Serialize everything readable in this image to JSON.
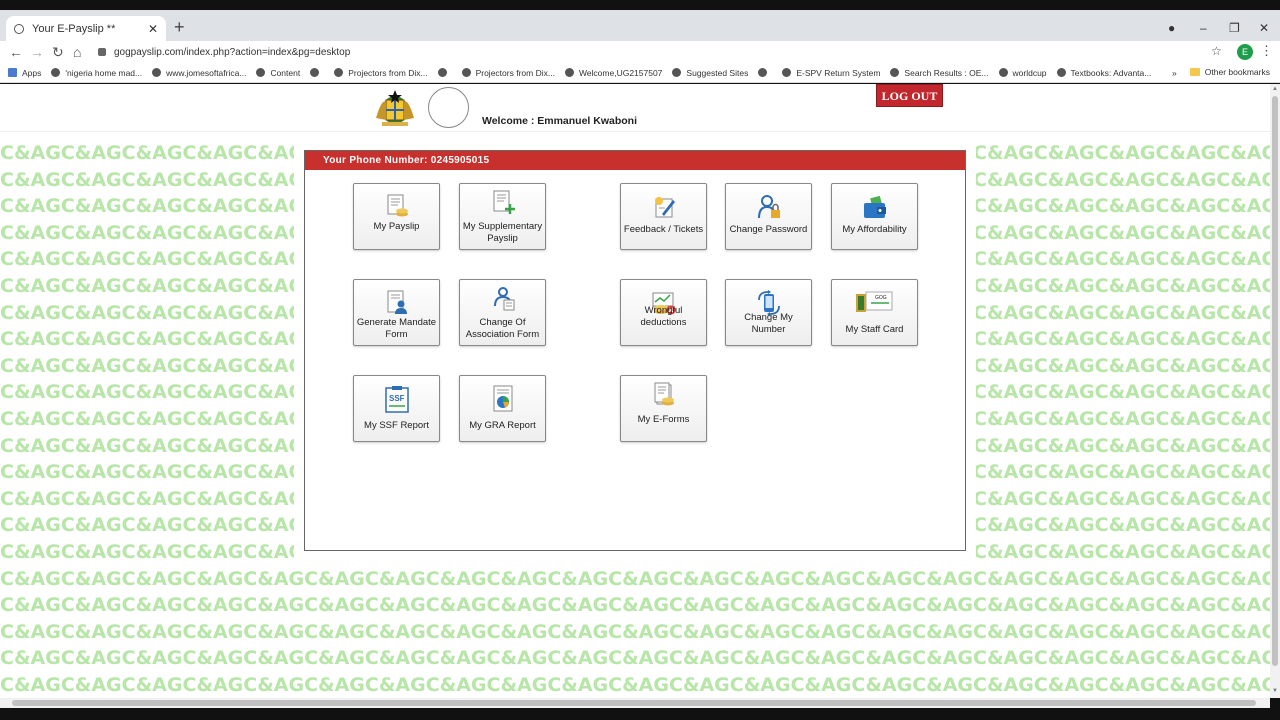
{
  "browser": {
    "tab_title": "Your E-Payslip **",
    "tab_close": "✕",
    "new_tab": "+",
    "url": "gogpayslip.com/index.php?action=index&pg=desktop",
    "profile_initial": "E",
    "window_controls": [
      "–",
      "❐",
      "✕"
    ],
    "bookmarks": [
      "Apps",
      "'nigeria home mad...",
      "www.jomesoftafrica...",
      "Content",
      "",
      "Projectors from Dix...",
      "",
      "Projectors from Dix...",
      "Welcome,UG2157507",
      "Suggested Sites",
      "",
      "E-SPV Return System",
      "Search Results : OE...",
      "worldcup",
      "Textbooks: Advanta..."
    ],
    "other_bookmarks": "Other bookmarks",
    "more_bookmarks": "»"
  },
  "header": {
    "welcome": "Welcome : Emmanuel Kwaboni",
    "logout": "LOG OUT"
  },
  "panel": {
    "phone_label": "Your Phone Number: 0245905015"
  },
  "pattern_text": "C&AGC&AGC&AGC&AGC&AGC&AGC&AGC&AGC&AGC&AGC&AGC&AGC&AGC&AGC&AGC&AGC&AGC&AGC&AGC&AGC&AGC&AGC&AGC&AGC&AGC&AG",
  "tiles": [
    {
      "label": "My Payslip",
      "icon": "payslip-icon"
    },
    {
      "label": "My Supplementary Payslip",
      "icon": "supplementary-payslip-icon"
    },
    {
      "label": "Feedback / Tickets",
      "icon": "feedback-icon"
    },
    {
      "label": "Change Password",
      "icon": "change-password-icon"
    },
    {
      "label": "My Affordability",
      "icon": "affordability-icon"
    },
    {
      "label": "Generate Mandate Form",
      "icon": "mandate-form-icon"
    },
    {
      "label": "Change Of Association Form",
      "icon": "association-form-icon"
    },
    {
      "label": "Wrongful deductions",
      "icon": "wrongful-deductions-icon"
    },
    {
      "label": "Change My Number",
      "icon": "change-number-icon"
    },
    {
      "label": "My Staff Card",
      "icon": "staff-card-icon"
    },
    {
      "label": "My SSF Report",
      "icon": "ssf-report-icon"
    },
    {
      "label": "My GRA Report",
      "icon": "gra-report-icon"
    },
    {
      "label": "My E-Forms",
      "icon": "e-forms-icon"
    }
  ],
  "ssf_icon_text": "SSF",
  "staff_card_icon_text": "GOG"
}
